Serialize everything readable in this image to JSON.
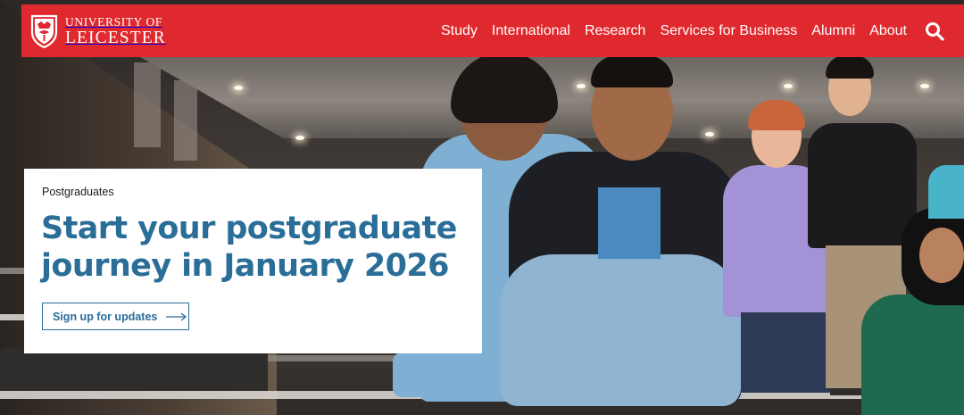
{
  "header": {
    "logo": {
      "line1": "UNIVERSITY OF",
      "line2": "LEICESTER"
    },
    "nav": [
      {
        "label": "Study"
      },
      {
        "label": "International"
      },
      {
        "label": "Research"
      },
      {
        "label": "Services for Business"
      },
      {
        "label": "Alumni"
      },
      {
        "label": "About"
      }
    ],
    "search_icon": "search-icon"
  },
  "hero": {
    "eyebrow": "Postgraduates",
    "title": "Start your postgraduate journey in January 2026",
    "cta_label": "Sign up for updates",
    "cta_icon": "arrow-right-icon"
  },
  "colors": {
    "brand_red": "#e0292e",
    "heading_blue": "#2a6e98",
    "card_bg": "#ffffff"
  }
}
